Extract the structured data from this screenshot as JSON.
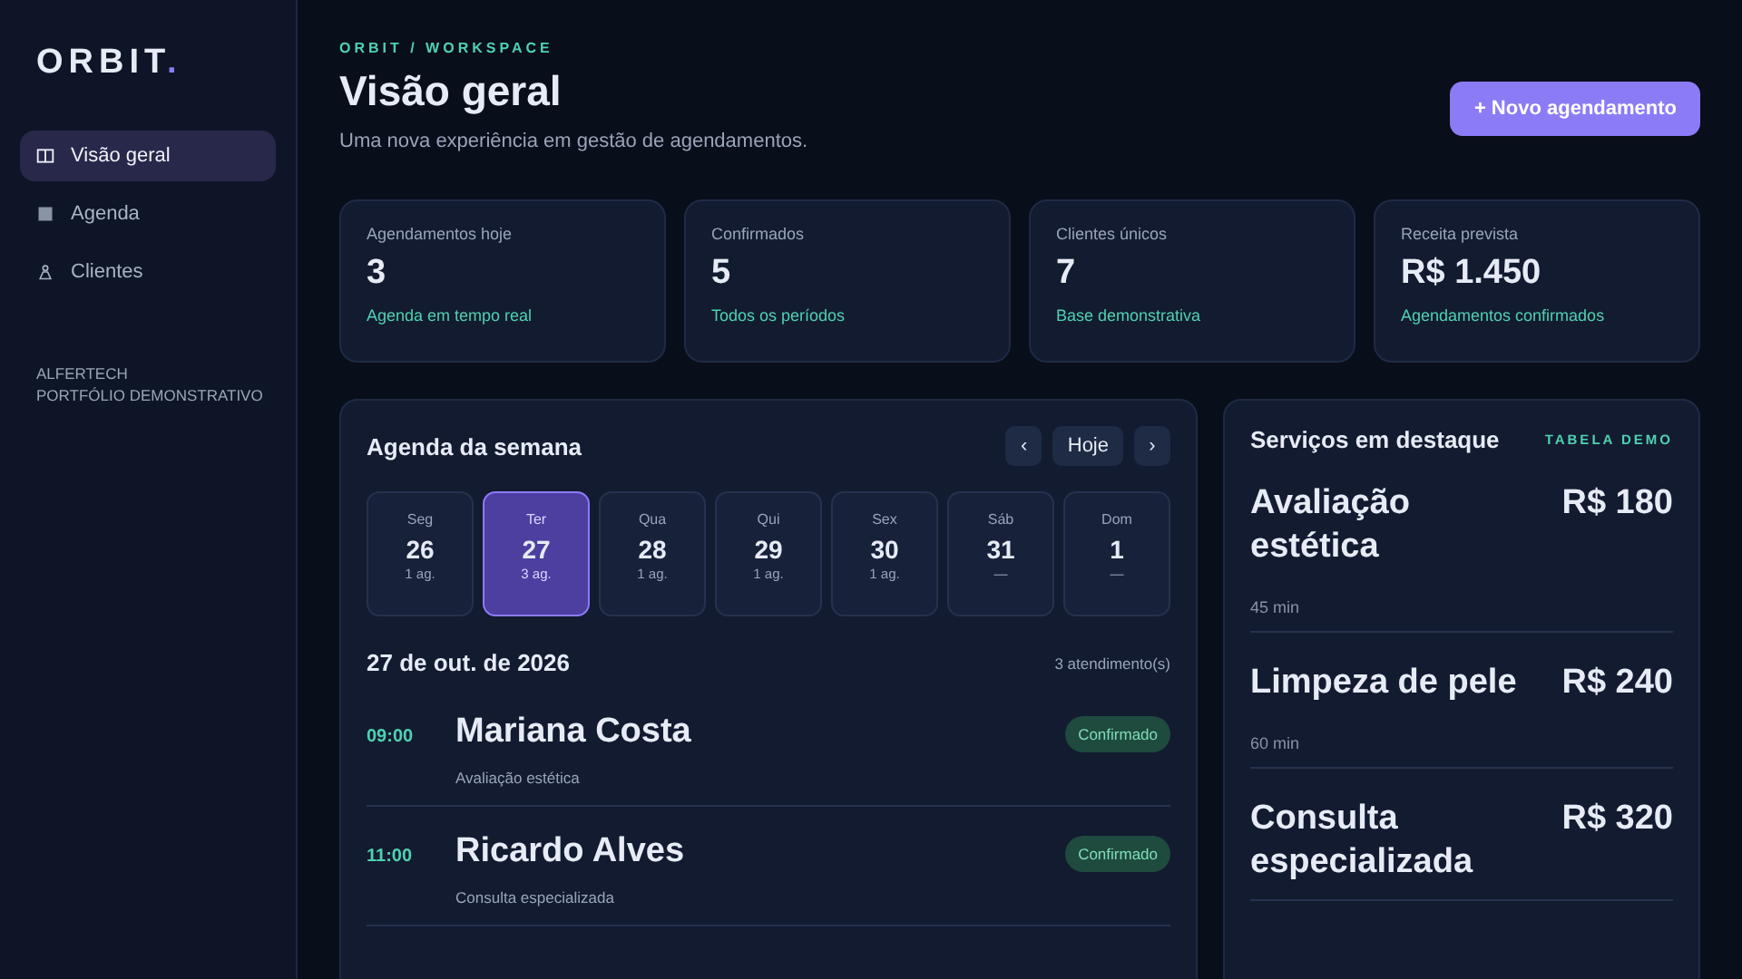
{
  "logo": {
    "text": "ORBIT",
    "mark": "."
  },
  "sidebar": {
    "items": [
      {
        "label": "Visão geral",
        "kind": "panel",
        "selected": true
      },
      {
        "label": "Agenda",
        "kind": "grid",
        "selected": false
      },
      {
        "label": "Clientes",
        "kind": "person",
        "selected": false
      }
    ],
    "footer": [
      "ALFERTECH",
      "PORTFÓLIO DEMONSTRATIVO"
    ]
  },
  "header": {
    "breadcrumb": "ORBIT / WORKSPACE",
    "title": "Visão geral",
    "subtitle": "Uma nova experiência em gestão de agendamentos.",
    "button": "+ Novo agendamento"
  },
  "stats": [
    {
      "label": "Agendamentos hoje",
      "value": "3",
      "note": "Agenda em tempo real"
    },
    {
      "label": "Confirmados",
      "value": "5",
      "note": "Todos os períodos"
    },
    {
      "label": "Clientes únicos",
      "value": "7",
      "note": "Base demonstrativa"
    },
    {
      "label": "Receita prevista",
      "value": "R$ 1.450",
      "note": "Agendamentos confirmados"
    }
  ],
  "week": {
    "title": "Agenda da semana",
    "prev": "‹",
    "today": "Hoje",
    "next": "›",
    "days": [
      {
        "name": "Seg",
        "date": "26",
        "count": "1 ag.",
        "selected": false
      },
      {
        "name": "Ter",
        "date": "27",
        "count": "3 ag.",
        "selected": true
      },
      {
        "name": "Qua",
        "date": "28",
        "count": "1 ag.",
        "selected": false
      },
      {
        "name": "Qui",
        "date": "29",
        "count": "1 ag.",
        "selected": false
      },
      {
        "name": "Sex",
        "date": "30",
        "count": "1 ag.",
        "selected": false
      },
      {
        "name": "Sáb",
        "date": "31",
        "count": "—",
        "selected": false
      },
      {
        "name": "Dom",
        "date": "1",
        "count": "—",
        "selected": false
      }
    ],
    "date": "27 de out. de 2026",
    "total": "3 atendimento(s)",
    "appointments": [
      {
        "time": "09:00",
        "client": "Mariana Costa",
        "service": "Avaliação estética",
        "status": "Confirmado"
      },
      {
        "time": "11:00",
        "client": "Ricardo Alves",
        "service": "Consulta especializada",
        "status": "Confirmado"
      }
    ]
  },
  "services": {
    "title": "Serviços em destaque",
    "tag": "TABELA DEMO",
    "items": [
      {
        "name": "Avaliação estética",
        "price": "R$ 180",
        "duration": "45 min"
      },
      {
        "name": "Limpeza de pele",
        "price": "R$ 240",
        "duration": "60 min"
      },
      {
        "name": "Consulta especializada",
        "price": "R$ 320"
      }
    ]
  }
}
